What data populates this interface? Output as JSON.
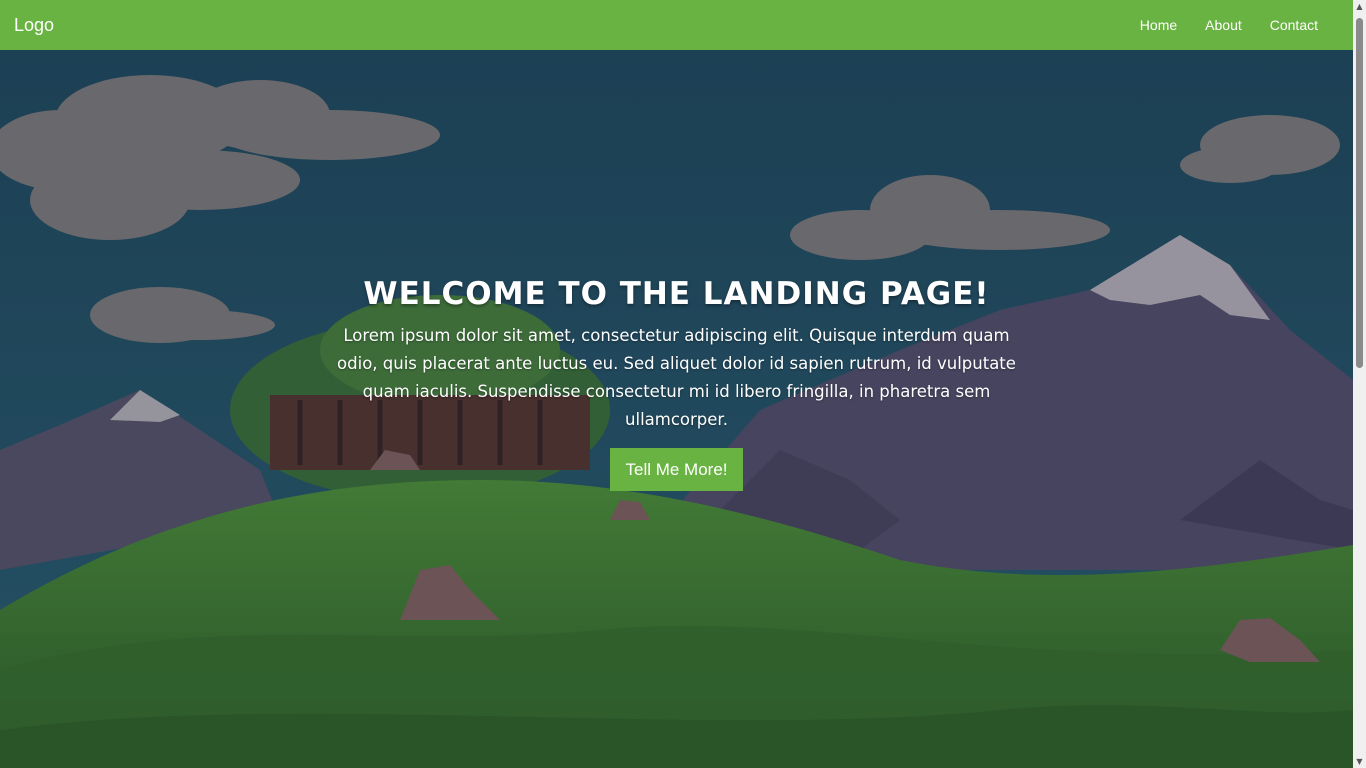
{
  "nav": {
    "logo": "Logo",
    "links": [
      {
        "label": "Home"
      },
      {
        "label": "About"
      },
      {
        "label": "Contact"
      }
    ]
  },
  "hero": {
    "title": "Welcome to the landing page!",
    "text": "Lorem ipsum dolor sit amet, consectetur adipiscing elit. Quisque interdum quam odio, quis placerat ante luctus eu. Sed aliquet dolor id sapien rutrum, id vulputate quam iaculis. Suspendisse consectetur mi id libero fringilla, in pharetra sem ullamcorper.",
    "button_label": "Tell Me More!"
  },
  "colors": {
    "accent": "#69b342",
    "sky": "#235a6a",
    "grass": "#3e7d2c"
  },
  "icons": {
    "scroll_up": "scroll-up-arrow-icon",
    "scroll_down": "scroll-down-arrow-icon"
  }
}
